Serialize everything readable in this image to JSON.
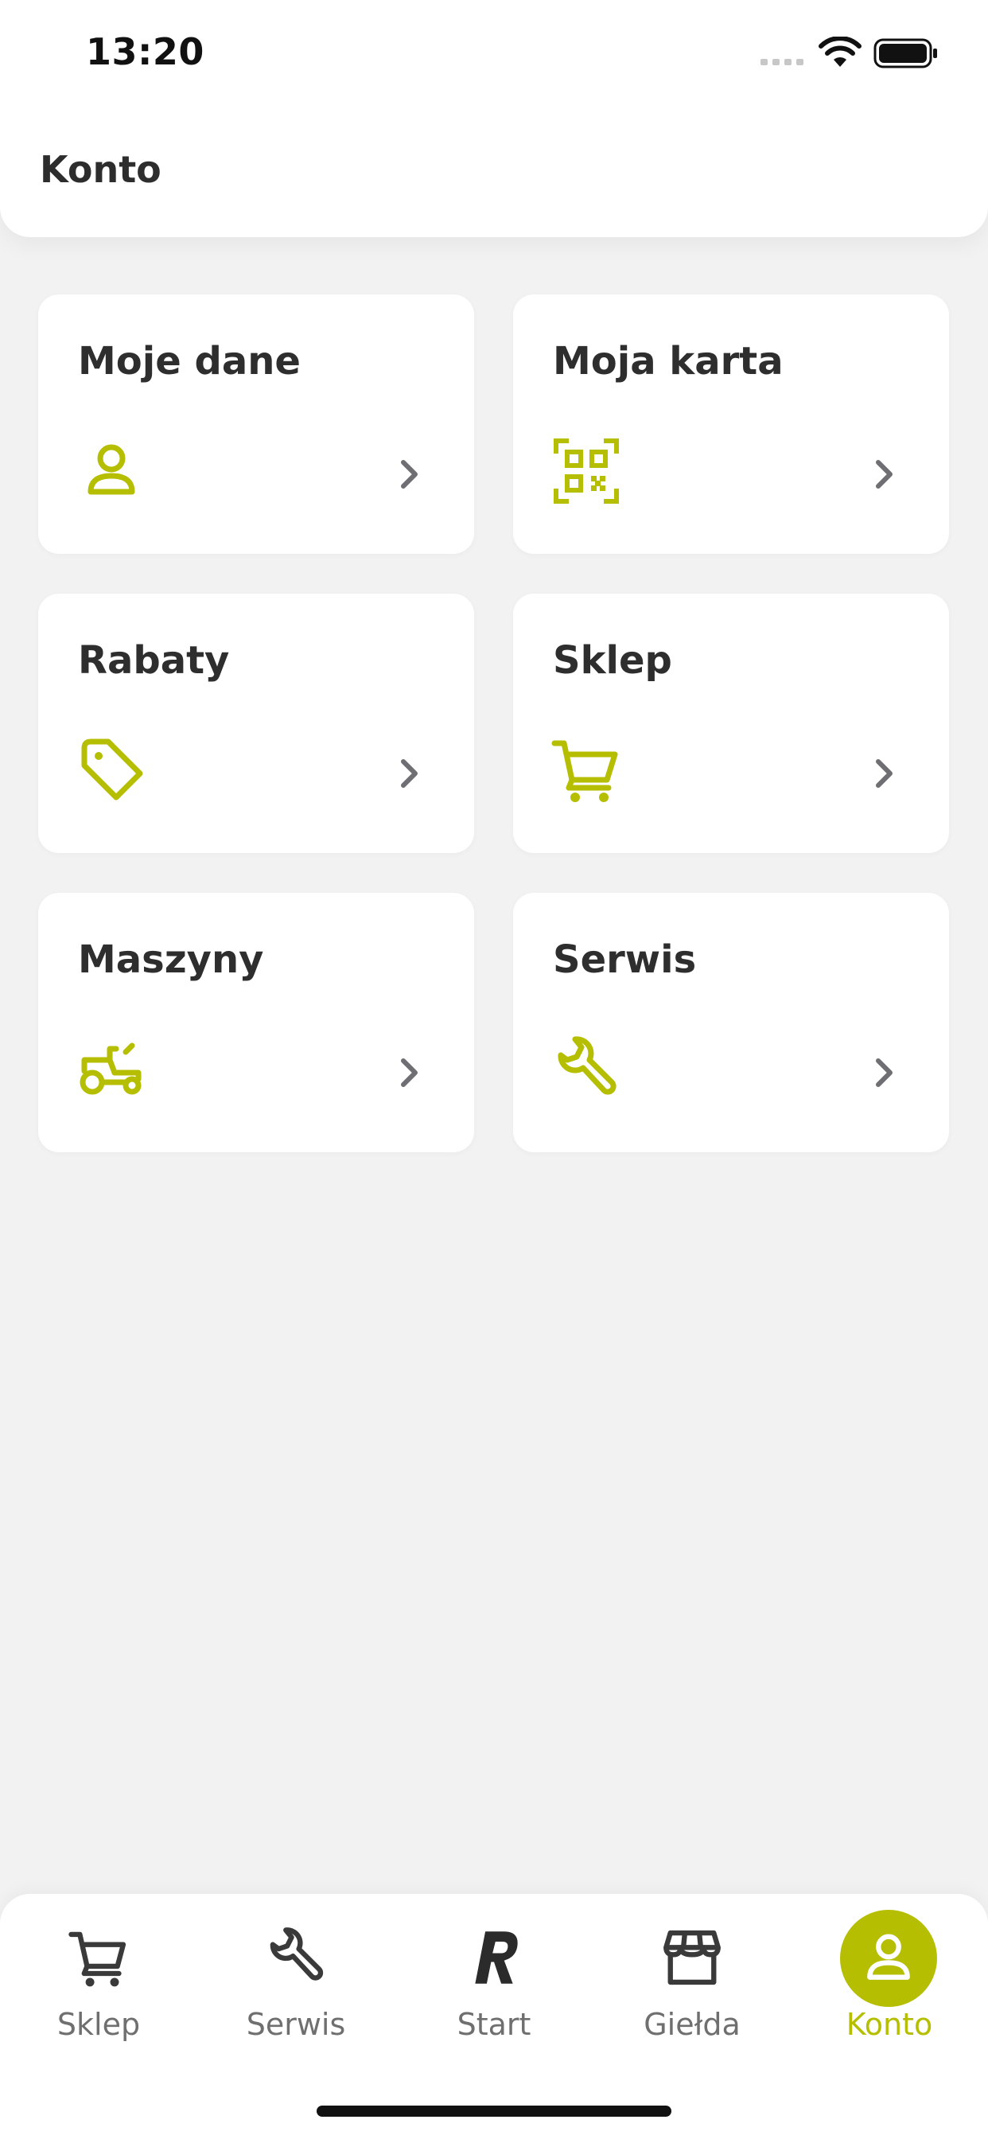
{
  "status_bar": {
    "time": "13:20"
  },
  "header": {
    "title": "Konto"
  },
  "theme": {
    "accent": "#b5be00",
    "chevron": "#6e6e73",
    "background": "#f2f2f2"
  },
  "cards": [
    {
      "label": "Moje dane",
      "icon": "user-icon"
    },
    {
      "label": "Moja karta",
      "icon": "qr-code-icon"
    },
    {
      "label": "Rabaty",
      "icon": "tag-icon"
    },
    {
      "label": "Sklep",
      "icon": "cart-icon"
    },
    {
      "label": "Maszyny",
      "icon": "tractor-icon"
    },
    {
      "label": "Serwis",
      "icon": "wrench-icon"
    }
  ],
  "bottom_nav": {
    "items": [
      {
        "label": "Sklep",
        "icon": "cart-icon",
        "active": false
      },
      {
        "label": "Serwis",
        "icon": "wrench-icon",
        "active": false
      },
      {
        "label": "Start",
        "icon": "logo-r-icon",
        "active": false
      },
      {
        "label": "Giełda",
        "icon": "store-icon",
        "active": false
      },
      {
        "label": "Konto",
        "icon": "user-icon",
        "active": true
      }
    ]
  }
}
